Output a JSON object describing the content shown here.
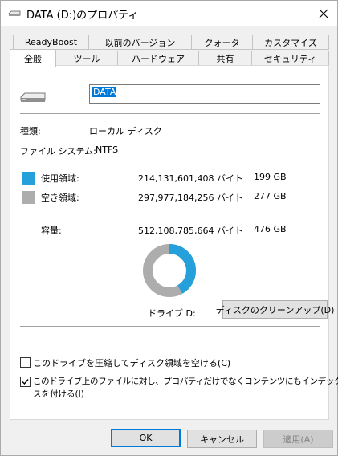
{
  "window": {
    "title": "DATA (D:)のプロパティ"
  },
  "tabs_row1": [
    "ReadyBoost",
    "以前のバージョン",
    "クォータ",
    "カスタマイズ"
  ],
  "tabs_row2": [
    "全般",
    "ツール",
    "ハードウェア",
    "共有",
    "セキュリティ"
  ],
  "active_tab": "全般",
  "general": {
    "volume_name": "DATA",
    "type_label": "種類:",
    "type_value": "ローカル ディスク",
    "fs_label": "ファイル システム:",
    "fs_value": "NTFS",
    "used_label": "使用領域:",
    "used_bytes": "214,131,601,408 バイト",
    "used_size": "199 GB",
    "free_label": "空き領域:",
    "free_bytes": "297,977,184,256 バイト",
    "free_size": "277 GB",
    "capacity_label": "容量:",
    "capacity_bytes": "512,108,785,664 バイト",
    "capacity_size": "476 GB",
    "drive_label": "ドライブ D:",
    "cleanup_button": "ディスクのクリーンアップ(D)",
    "compress_label": "このドライブを圧縮してディスク領域を空ける(C)",
    "index_label_line1": "このドライブ上のファイルに対し、プロパティだけでなくコンテンツにもインデック",
    "index_label_line2": "スを付ける(I)",
    "compress_checked": false,
    "index_checked": true
  },
  "usage": {
    "used_fraction": 0.418,
    "used_color": "#26a0da",
    "free_color": "#adadad"
  },
  "buttons": {
    "ok": "OK",
    "cancel": "キャンセル",
    "apply": "適用(A)"
  }
}
